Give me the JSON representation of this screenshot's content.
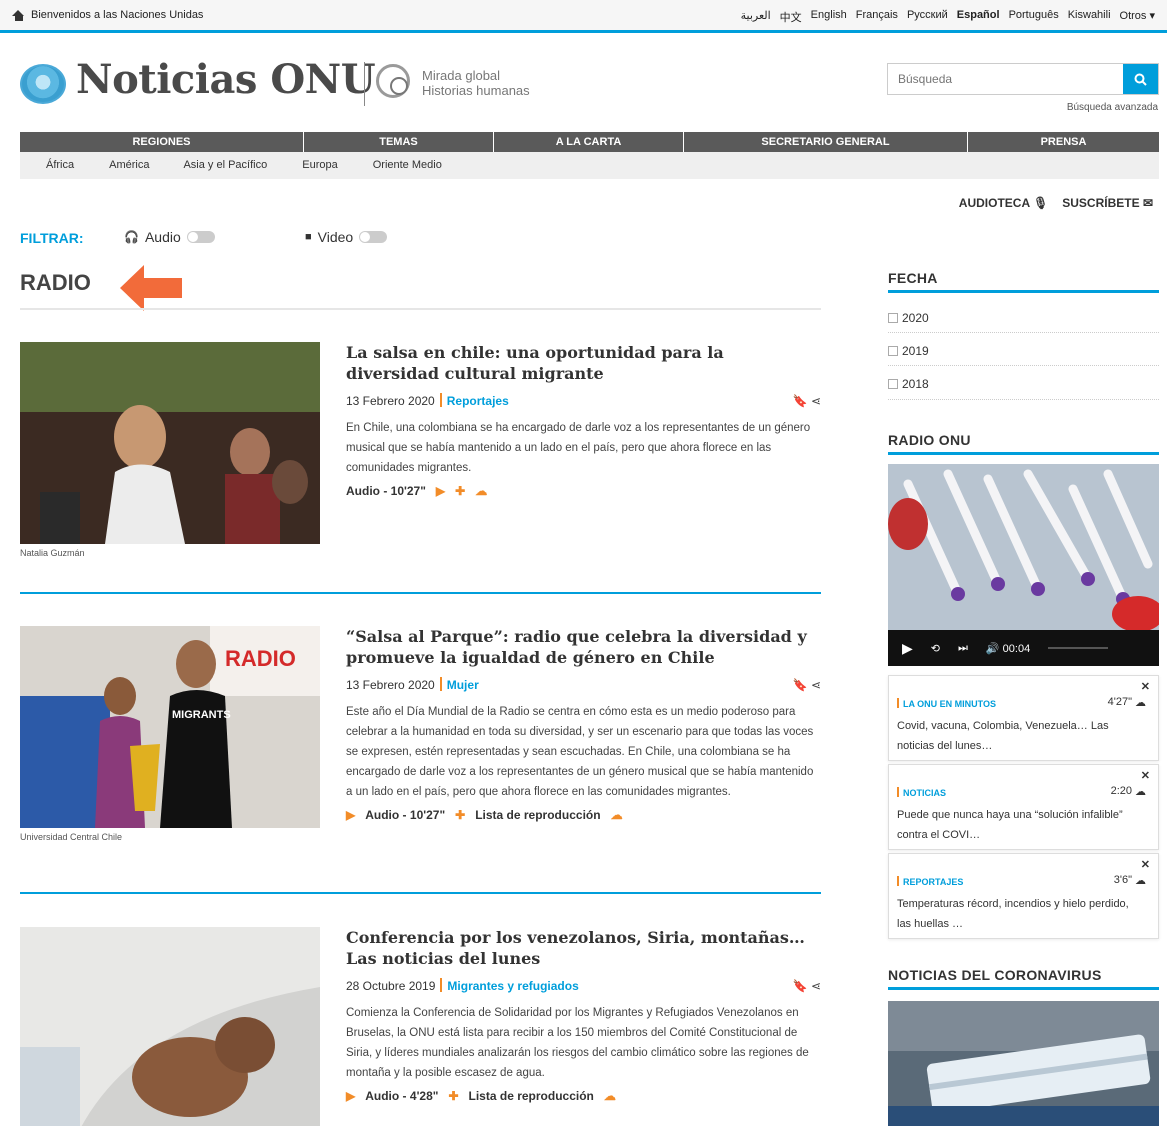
{
  "topbar": {
    "welcome": "Bienvenidos a las Naciones Unidas",
    "languages": [
      "العربية",
      "中文",
      "English",
      "Français",
      "Русский",
      "Español",
      "Português",
      "Kiswahili",
      "Otros ▾"
    ],
    "active_language": "Español"
  },
  "header": {
    "logo": "Noticias ONU",
    "tagline1": "Mirada global",
    "tagline2": "Historias humanas",
    "search_placeholder": "Búsqueda",
    "advanced_search": "Búsqueda avanzada"
  },
  "nav": {
    "items": [
      "REGIONES",
      "TEMAS",
      "A LA CARTA",
      "SECRETARIO GENERAL",
      "PRENSA"
    ],
    "subitems": [
      "África",
      "América",
      "Asia y el Pacífico",
      "Europa",
      "Oriente Medio"
    ]
  },
  "utility": {
    "audioteca": "AUDIOTECA",
    "suscribete": "SUSCRÍBETE"
  },
  "filter": {
    "label": "FILTRAR:",
    "audio": "Audio",
    "video": "Video"
  },
  "section_title": "RADIO",
  "articles": [
    {
      "title": "La salsa en chile: una oportunidad para la diversidad cultural migrante",
      "date": "13 Febrero 2020",
      "category": "Reportajes",
      "excerpt": "En Chile, una colombiana se ha encargado de darle voz a los representantes de un género musical que se había mantenido a un lado en el país, pero que ahora florece en las comunidades migrantes.",
      "audio": "Audio - 10'27\"",
      "credit": "Natalia Guzmán"
    },
    {
      "title": "“Salsa al Parque”: radio que celebra la diversidad y promueve la igualdad de género en Chile",
      "date": "13 Febrero 2020",
      "category": "Mujer",
      "excerpt": "Este año el Día Mundial de la Radio se centra en cómo esta es un medio poderoso para celebrar a la humanidad en toda su diversidad, y ser un escenario para que todas las voces se expresen, estén representadas y sean escuchadas. En Chile, una colombiana se ha encargado de darle voz a los representantes de un género musical que se había mantenido a un lado en el país, pero que ahora florece en las comunidades migrantes.",
      "audio": "Audio - 10'27\"",
      "playlist": "Lista de reproducción",
      "credit": "Universidad Central Chile"
    },
    {
      "title": "Conferencia por los venezolanos, Siria, montañas… Las noticias del lunes",
      "date": "28 Octubre 2019",
      "category": "Migrantes y refugiados",
      "excerpt": "Comienza la Conferencia de Solidaridad por los Migrantes y Refugiados Venezolanos en Bruselas, la ONU está lista para recibir a los 150 miembros del Comité Constitucional de Siria, y líderes mundiales analizarán los riesgos del cambio climático sobre las regiones de montaña y la posible escasez de agua.",
      "audio": "Audio - 4'28\"",
      "playlist": "Lista de reproducción"
    }
  ],
  "sidebar": {
    "fecha_title": "FECHA",
    "years": [
      "2020",
      "2019",
      "2018"
    ],
    "radio_title": "RADIO ONU",
    "player_time": "00:04",
    "playlist": [
      {
        "tag": "LA ONU EN MINUTOS",
        "duration": "4'27\"",
        "text": "Covid, vacuna, Colombia, Venezuela… Las noticias del lunes…"
      },
      {
        "tag": "NOTICIAS",
        "duration": "2:20",
        "text": "Puede que nunca haya una “solución infalible” contra el COVI…"
      },
      {
        "tag": "REPORTAJES",
        "duration": "3'6\"",
        "text": "Temperaturas récord, incendios y hielo perdido, las huellas …"
      }
    ],
    "corona_title": "NOTICIAS DEL CORONAVIRUS"
  },
  "colors": {
    "accent": "#009edb",
    "orange": "#f28c28",
    "nav": "#5a5a5a"
  }
}
